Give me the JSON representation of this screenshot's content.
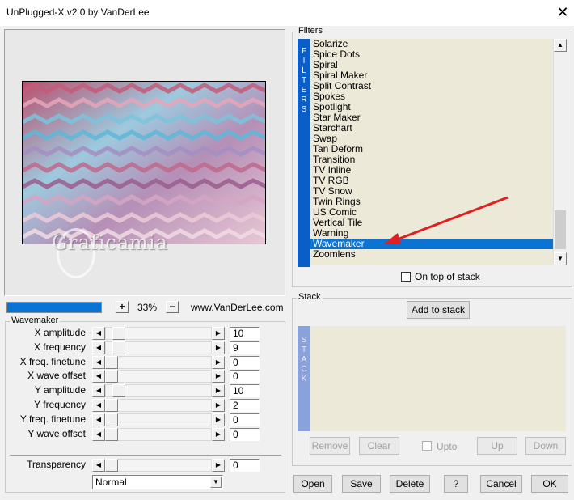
{
  "window": {
    "title": "UnPlugged-X v2.0 by VanDerLee",
    "close_glyph": "✕"
  },
  "preview": {
    "watermark": "Graficamia"
  },
  "zoom": {
    "plus": "+",
    "minus": "−",
    "value": "33%",
    "site": "www.VanDerLee.com"
  },
  "wavemaker": {
    "group_label": "Wavemaker",
    "params": [
      {
        "label": "X amplitude",
        "value": "10"
      },
      {
        "label": "X frequency",
        "value": "9"
      },
      {
        "label": "X freq. finetune",
        "value": "0"
      },
      {
        "label": "X wave offset",
        "value": "0"
      },
      {
        "label": "Y amplitude",
        "value": "10"
      },
      {
        "label": "Y frequency",
        "value": "2"
      },
      {
        "label": "Y freq. finetune",
        "value": "0"
      },
      {
        "label": "Y wave offset",
        "value": "0"
      }
    ],
    "transparency": {
      "label": "Transparency",
      "value": "0"
    },
    "blend_mode": "Normal"
  },
  "filters": {
    "group_label": "Filters",
    "side_letters": [
      "F",
      "I",
      "L",
      "T",
      "E",
      "R",
      "S"
    ],
    "items": [
      "Solarize",
      "Spice Dots",
      "Spiral",
      "Spiral Maker",
      "Split Contrast",
      "Spokes",
      "Spotlight",
      "Star Maker",
      "Starchart",
      "Swap",
      "Tan Deform",
      "Transition",
      "TV Inline",
      "TV RGB",
      "TV Snow",
      "Twin Rings",
      "US Comic",
      "Vertical Tile",
      "Warning",
      "Wavemaker",
      "Zoomlens"
    ],
    "selected": "Wavemaker",
    "on_top_label": "On top of stack"
  },
  "stack": {
    "group_label": "Stack",
    "add_button": "Add to stack",
    "side_letters": [
      "S",
      "T",
      "A",
      "C",
      "K"
    ],
    "remove": "Remove",
    "clear": "Clear",
    "upto": "Upto",
    "up": "Up",
    "down": "Down"
  },
  "footer": {
    "open": "Open",
    "save": "Save",
    "delete": "Delete",
    "help": "?",
    "cancel": "Cancel",
    "ok": "OK"
  },
  "colors": {
    "accent": "#0a74d6",
    "filter_strip": "#0a5ec8",
    "stack_strip": "#8aa2dc",
    "list_bg": "#ece9d8",
    "annotation": "#e02020"
  }
}
